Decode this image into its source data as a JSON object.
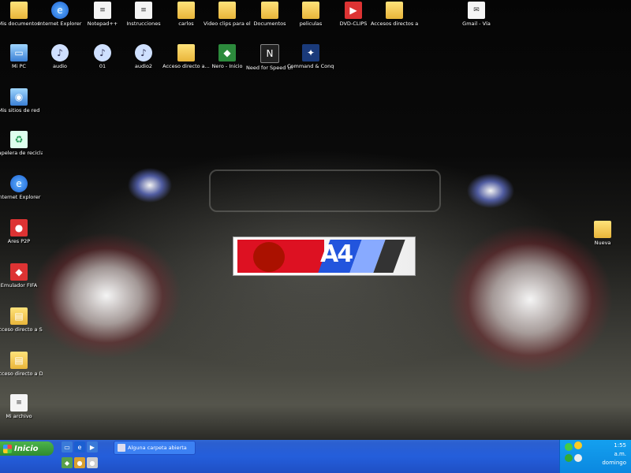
{
  "desktop": {
    "icons": [
      {
        "label": "Mis documentos",
        "glyph": "📁"
      },
      {
        "label": "Internet Explorer",
        "glyph": "e"
      },
      {
        "label": "Notepad++",
        "glyph": "≡"
      },
      {
        "label": "Instrucciones",
        "glyph": "≡"
      },
      {
        "label": "carlos",
        "glyph": ""
      },
      {
        "label": "Video clips para el coche",
        "glyph": ""
      },
      {
        "label": "Documentos",
        "glyph": ""
      },
      {
        "label": "peliculas",
        "glyph": ""
      },
      {
        "label": "DVD-CLIPS",
        "glyph": "▶"
      },
      {
        "label": "Accesos directos a cosas",
        "glyph": ""
      },
      {
        "label": "Gmail - Vía",
        "glyph": "✉"
      },
      {
        "label": "Mi PC",
        "glyph": "▭"
      },
      {
        "label": "audio",
        "glyph": "♪"
      },
      {
        "label": "01",
        "glyph": "♪"
      },
      {
        "label": "audio2",
        "glyph": "♪"
      },
      {
        "label": "Acceso directo a...",
        "glyph": ""
      },
      {
        "label": "Nero - Inicio",
        "glyph": "◆"
      },
      {
        "label": "Need for Speed Under...",
        "glyph": "N"
      },
      {
        "label": "Command & Conquer...",
        "glyph": "✦"
      },
      {
        "label": "Mis sitios de red",
        "glyph": "◉"
      },
      {
        "label": "Papelera de reciclaje",
        "glyph": "♻"
      },
      {
        "label": "Internet Explorer",
        "glyph": "e"
      },
      {
        "label": "Ares P2P",
        "glyph": "●"
      },
      {
        "label": "Emulador FIFA",
        "glyph": "◆"
      },
      {
        "label": "Acceso directo a Setup",
        "glyph": "▤"
      },
      {
        "label": "Acceso directo a Documents",
        "glyph": "▤"
      },
      {
        "label": "Mi archivo",
        "glyph": "≡"
      },
      {
        "label": "Nueva",
        "glyph": ""
      }
    ]
  },
  "taskbar": {
    "start_label": "Inicio",
    "window_button": "Alguna carpeta abierta",
    "clock_time": "1:55",
    "clock_line2": "a.m.",
    "clock_line3": "domingo"
  },
  "plate": {
    "text": "A4"
  }
}
